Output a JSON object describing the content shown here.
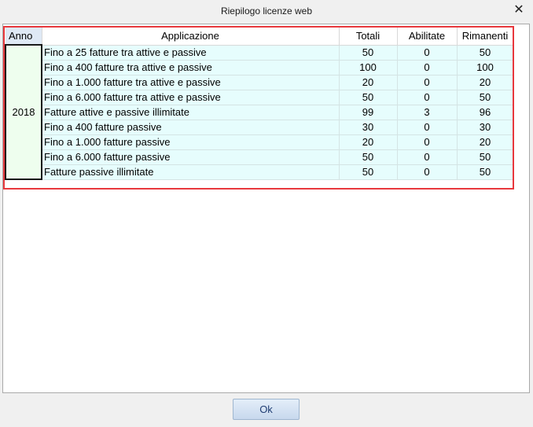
{
  "window": {
    "title": "Riepilogo licenze web",
    "close_glyph": "✕"
  },
  "table": {
    "headers": {
      "anno": "Anno",
      "applicazione": "Applicazione",
      "totali": "Totali",
      "abilitate": "Abilitate",
      "rimanenti": "Rimanenti"
    },
    "year": "2018",
    "rows": [
      {
        "app": "Fino a 25 fatture tra attive e passive",
        "totali": "50",
        "abilitate": "0",
        "rimanenti": "50"
      },
      {
        "app": "Fino a 400 fatture tra attive e passive",
        "totali": "100",
        "abilitate": "0",
        "rimanenti": "100"
      },
      {
        "app": "Fino a 1.000 fatture tra attive e passive",
        "totali": "20",
        "abilitate": "0",
        "rimanenti": "20"
      },
      {
        "app": "Fino a 6.000 fatture tra attive e passive",
        "totali": "50",
        "abilitate": "0",
        "rimanenti": "50"
      },
      {
        "app": "Fatture attive e passive illimitate",
        "totali": "99",
        "abilitate": "3",
        "rimanenti": "96"
      },
      {
        "app": "Fino a 400 fatture passive",
        "totali": "30",
        "abilitate": "0",
        "rimanenti": "30"
      },
      {
        "app": "Fino a 1.000 fatture passive",
        "totali": "20",
        "abilitate": "0",
        "rimanenti": "20"
      },
      {
        "app": "Fino a 6.000 fatture passive",
        "totali": "50",
        "abilitate": "0",
        "rimanenti": "50"
      },
      {
        "app": "Fatture passive illimitate",
        "totali": "50",
        "abilitate": "0",
        "rimanenti": "50"
      }
    ]
  },
  "footer": {
    "ok_label": "Ok"
  },
  "colors": {
    "highlight_border": "#e8383d",
    "row_background": "#e6fdfd",
    "year_cell_background": "#eefeee"
  }
}
